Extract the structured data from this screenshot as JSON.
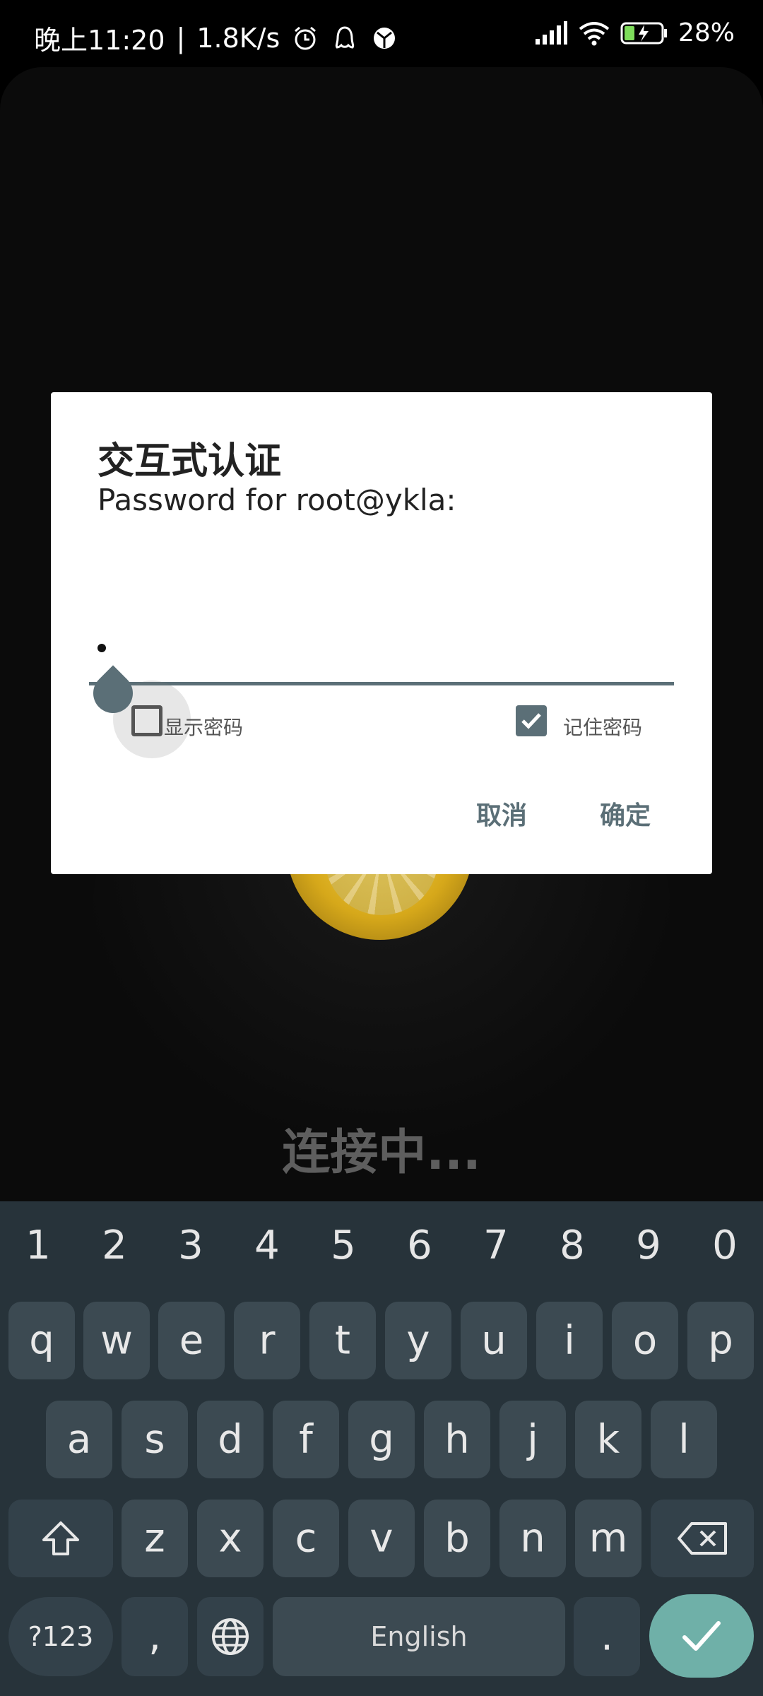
{
  "statusbar": {
    "time": "晚上11:20",
    "speed": "1.8K/s",
    "battery": "28%",
    "icons": [
      "alarm-icon",
      "qq-icon",
      "app-icon",
      "signal-icon",
      "wifi-icon",
      "battery-charging-icon"
    ]
  },
  "background": {
    "status_text": "连接中..."
  },
  "dialog": {
    "title": "交互式认证",
    "message": "Password for root@ykla:",
    "password_value": "•",
    "show_password_label": "显示密码",
    "show_password_checked": false,
    "remember_password_label": "记住密码",
    "remember_password_checked": true,
    "cancel_label": "取消",
    "ok_label": "确定"
  },
  "keyboard": {
    "numbers": [
      "1",
      "2",
      "3",
      "4",
      "5",
      "6",
      "7",
      "8",
      "9",
      "0"
    ],
    "row1": [
      "q",
      "w",
      "e",
      "r",
      "t",
      "y",
      "u",
      "i",
      "o",
      "p"
    ],
    "row2": [
      "a",
      "s",
      "d",
      "f",
      "g",
      "h",
      "j",
      "k",
      "l"
    ],
    "row3": [
      "z",
      "x",
      "c",
      "v",
      "b",
      "n",
      "m"
    ],
    "symbols_label": "?123",
    "comma": ",",
    "space_label": "English",
    "period": "."
  },
  "colors": {
    "accent": "#5b6f77",
    "keyboard_bg": "#27333a",
    "enter_key": "#6fb0a8"
  }
}
